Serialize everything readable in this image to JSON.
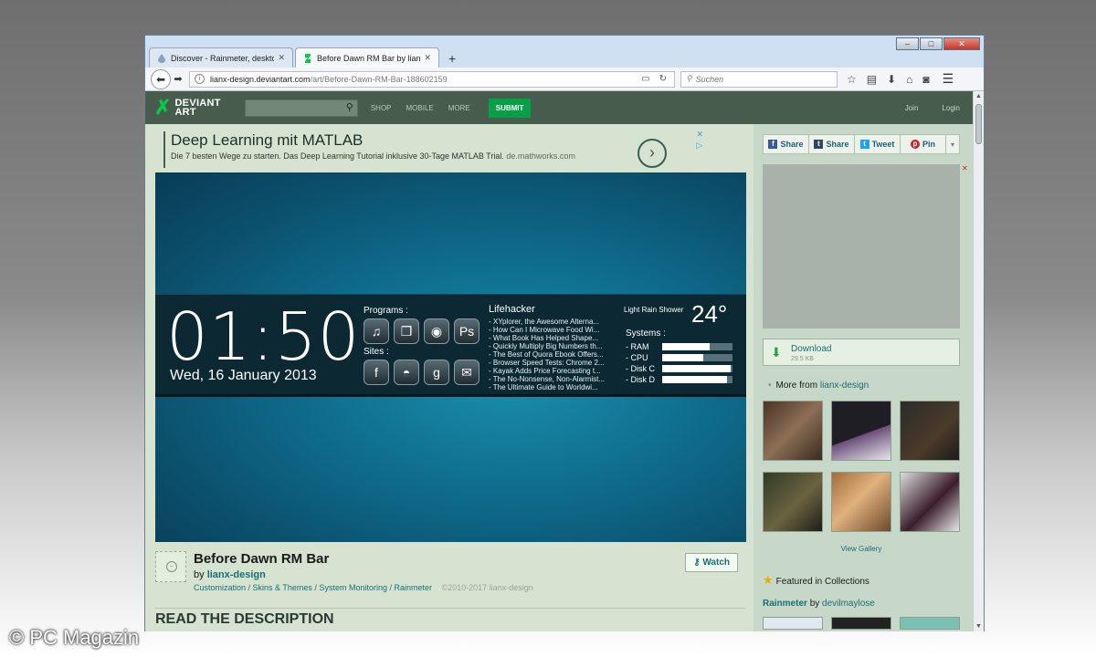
{
  "watermark": "© PC Magazin",
  "browser": {
    "window_controls": {
      "minimize": "–",
      "maximize": "□",
      "close": "✕"
    },
    "tabs": [
      {
        "title": "Discover - Rainmeter, deskto",
        "close": "✕",
        "icon": "droplet-icon"
      },
      {
        "title": "Before Dawn RM Bar by lian",
        "close": "✕",
        "icon": "deviantart-icon"
      }
    ],
    "new_tab": "+",
    "url_domain": "lianx-design.deviantart.com",
    "url_path": "/art/Before-Dawn-RM-Bar-188602159",
    "search_placeholder": "Suchen"
  },
  "da": {
    "logo_line1": "DEVIANT",
    "logo_line2": "ART",
    "nav": [
      "SHOP",
      "MOBILE",
      "MORE"
    ],
    "submit": "SUBMIT",
    "join": "Join",
    "login": "Login"
  },
  "ad": {
    "title": "Deep Learning mit MATLAB",
    "desc": "Die 7 besten Wege zu starten. Das Deep Learning Tutorial inklusive 30-Tage MATLAB Trial.",
    "domain": "de.mathworks.com"
  },
  "skin": {
    "time": "01:50",
    "date": "Wed, 16 January 2013",
    "programs_label": "Programs :",
    "sites_label": "Sites :",
    "programs": [
      "♫",
      "❐",
      "◉",
      "Ps"
    ],
    "sites": [
      "f",
      "◓",
      "g",
      "✉"
    ],
    "lifehacker_title": "Lifehacker",
    "lifehacker_items": [
      "- XYplorer, the Awesome Alterna...",
      "- How Can I Microwave Food Wi...",
      "- What Book Has Helped Shape...",
      "- Quickly Multiply Big Numbers th...",
      "- The Best of Quora Ebook Offers...",
      "- Browser Speed Tests: Chrome 2...",
      "- Kayak Adds Price Forecasting t...",
      "- The No-Nonsense, Non-Alarmist...",
      "- The Ultimate Guide to Worldwi..."
    ],
    "weather": "Light Rain Shower",
    "temperature": "24°",
    "systems_label": "Systems :",
    "meters": [
      {
        "label": "- RAM",
        "level": 0.68
      },
      {
        "label": "- CPU",
        "level": 0.58
      },
      {
        "label": "- Disk C",
        "level": 0.97
      },
      {
        "label": "- Disk D",
        "level": 0.92
      }
    ]
  },
  "deviation": {
    "title": "Before Dawn RM Bar",
    "by": "by",
    "author": "lianx-design",
    "categories": [
      "Customization",
      "Skins & Themes",
      "System Monitoring",
      "Rainmeter"
    ],
    "copyright": "©2010-2017 lianx-design",
    "watch": "Watch",
    "read_description": "READ THE DESCRIPTION"
  },
  "sidebar": {
    "share": [
      "Share",
      "Share",
      "Tweet",
      "Pin"
    ],
    "download_label": "Download",
    "download_size": "29.5 KB",
    "more_from": "More from",
    "more_from_user": "lianx-design",
    "view_gallery": "View Gallery",
    "featured": "Featured in Collections",
    "collection_name": "Rainmeter",
    "collection_by": "by",
    "collection_user": "devilmaylose"
  }
}
